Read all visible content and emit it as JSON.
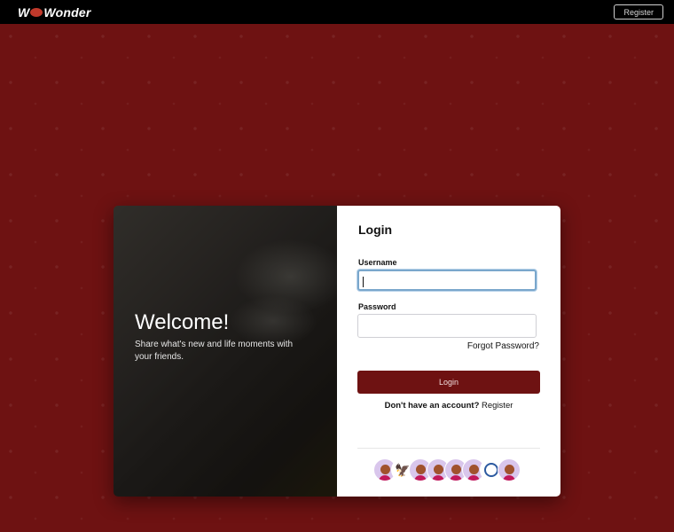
{
  "topbar": {
    "logo_text_left": "W",
    "logo_text_right": "Wonder",
    "register_label": "Register"
  },
  "welcome": {
    "heading": "Welcome!",
    "subtitle": "Share what's new and life moments with your friends."
  },
  "login": {
    "title": "Login",
    "username_label": "Username",
    "username_value": "",
    "password_label": "Password",
    "password_value": "",
    "forgot_label": "Forgot Password?",
    "button_label": "Login",
    "no_account_text": "Don't have an account?",
    "register_link": "Register"
  },
  "colors": {
    "brand": "#6e1212",
    "topbar": "#000000",
    "input_focus": "#7aa7cc"
  },
  "avatars": [
    "user-avatar",
    "bird-logo-avatar",
    "user-avatar",
    "user-avatar",
    "user-avatar",
    "user-avatar",
    "circle-logo-avatar",
    "user-avatar"
  ]
}
